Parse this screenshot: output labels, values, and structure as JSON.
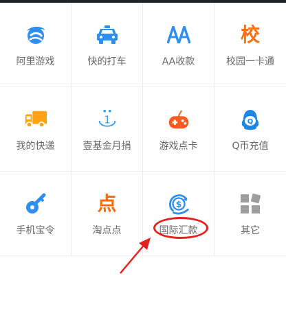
{
  "services": {
    "row1": [
      {
        "label": "阿里游戏",
        "icon": "ali-games-icon",
        "color": "#2f8ff0"
      },
      {
        "label": "快的打车",
        "icon": "taxi-icon",
        "color": "#2f8ff0"
      },
      {
        "label": "AA收款",
        "icon": "aa-collection-icon",
        "color": "#2f8ff0"
      },
      {
        "label": "校园一卡通",
        "icon": "campus-card-icon",
        "color": "#ff6f0f",
        "icon_text": "校"
      }
    ],
    "row2": [
      {
        "label": "我的快递",
        "icon": "delivery-truck-icon",
        "color": "#ffa312"
      },
      {
        "label": "壹基金月捐",
        "icon": "one-foundation-icon",
        "color": "#3aa0e8",
        "icon_text": "1"
      },
      {
        "label": "游戏点卡",
        "icon": "game-controller-icon",
        "color": "#ff5a1f"
      },
      {
        "label": "Q币充值",
        "icon": "qq-penguin-icon",
        "color": "#1e86e4",
        "icon_text": "Q"
      }
    ],
    "row3": [
      {
        "label": "手机宝令",
        "icon": "key-icon",
        "color": "#2f8ff0"
      },
      {
        "label": "淘点点",
        "icon": "taodiandian-icon",
        "color": "#ff6a00",
        "icon_text": "点"
      },
      {
        "label": "国际汇款",
        "icon": "international-remittance-icon",
        "color": "#2f8ff0",
        "icon_text": "$"
      },
      {
        "label": "其它",
        "icon": "more-grid-icon",
        "color": "#9e9e9e"
      }
    ]
  },
  "annotation": {
    "highlight_color": "#e32220",
    "highlighted_item": "国际汇款"
  }
}
